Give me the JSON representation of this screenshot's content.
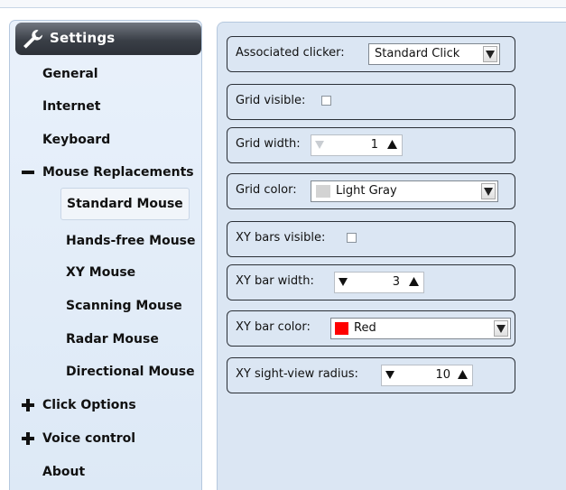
{
  "sidebar": {
    "header_title": "Settings",
    "items": {
      "general": "General",
      "internet": "Internet",
      "keyboard": "Keyboard",
      "mouse_replacements": "Mouse Replacements",
      "standard_mouse": "Standard Mouse",
      "hands_free_mouse": "Hands-free Mouse",
      "xy_mouse": "XY Mouse",
      "scanning_mouse": "Scanning Mouse",
      "radar_mouse": "Radar Mouse",
      "directional_mouse": "Directional Mouse",
      "click_options": "Click Options",
      "voice_control": "Voice control",
      "about": "About"
    },
    "selected": "Standard Mouse"
  },
  "settings": {
    "associated_clicker": {
      "label": "Associated clicker:",
      "value": "Standard Click"
    },
    "grid_visible": {
      "label": "Grid visible:",
      "checked": false
    },
    "grid_width": {
      "label": "Grid width:",
      "value": "1"
    },
    "grid_color": {
      "label": "Grid color:",
      "value": "Light Gray",
      "swatch": "#d3d3d3"
    },
    "xy_bars_visible": {
      "label": "XY bars visible:",
      "checked": false
    },
    "xy_bar_width": {
      "label": "XY bar width:",
      "value": "3"
    },
    "xy_bar_color": {
      "label": "XY bar color:",
      "value": "Red",
      "swatch": "#ff0000"
    },
    "xy_sight_view_radius": {
      "label": "XY sight-view radius:",
      "value": "10"
    }
  },
  "icons": {
    "header": "wrench-icon",
    "expanded": "minus-icon",
    "collapsed": "plus-icon",
    "dropdown": "triangle-down-icon",
    "increment": "triangle-up-icon",
    "decrement": "triangle-down-icon"
  }
}
